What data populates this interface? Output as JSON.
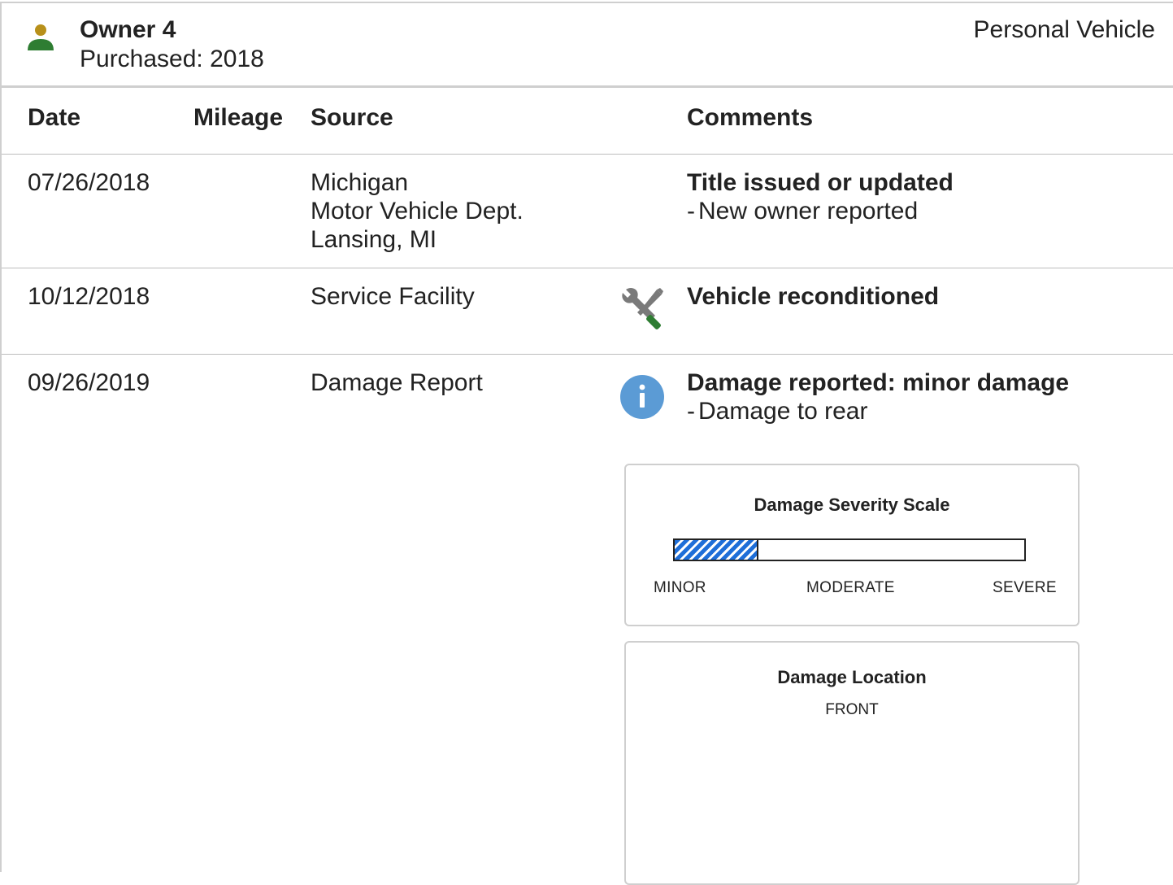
{
  "owner": {
    "title": "Owner 4",
    "purchased": "Purchased: 2018",
    "vehicle_type": "Personal Vehicle",
    "icon": "person-icon",
    "icon_colors": {
      "head": "#b8901a",
      "body": "#2e7d32"
    }
  },
  "table": {
    "headers": {
      "date": "Date",
      "mileage": "Mileage",
      "source": "Source",
      "comments": "Comments"
    },
    "rows": [
      {
        "date": "07/26/2018",
        "mileage": "",
        "source": [
          "Michigan",
          "Motor Vehicle Dept.",
          "Lansing, MI"
        ],
        "icon": "",
        "comment_title": "Title issued or updated",
        "comment_items": [
          "New owner reported"
        ]
      },
      {
        "date": "10/12/2018",
        "mileage": "",
        "source": [
          "Service Facility"
        ],
        "icon": "wrench-screwdriver-icon",
        "comment_title": "Vehicle reconditioned",
        "comment_items": []
      },
      {
        "date": "09/26/2019",
        "mileage": "",
        "source": [
          "Damage Report"
        ],
        "icon": "info-icon",
        "comment_title": "Damage reported: minor damage",
        "comment_items": [
          "Damage to rear"
        ]
      }
    ]
  },
  "severity_panel": {
    "title": "Damage Severity Scale",
    "level_fraction": 0.24,
    "fill_color": "#1e6ed8",
    "labels": {
      "minor": "MINOR",
      "moderate": "MODERATE",
      "severe": "SEVERE"
    }
  },
  "location_panel": {
    "title": "Damage Location",
    "front_label": "FRONT"
  },
  "colors": {
    "info_blue": "#5b9bd5",
    "divider": "#bdbdbd"
  }
}
